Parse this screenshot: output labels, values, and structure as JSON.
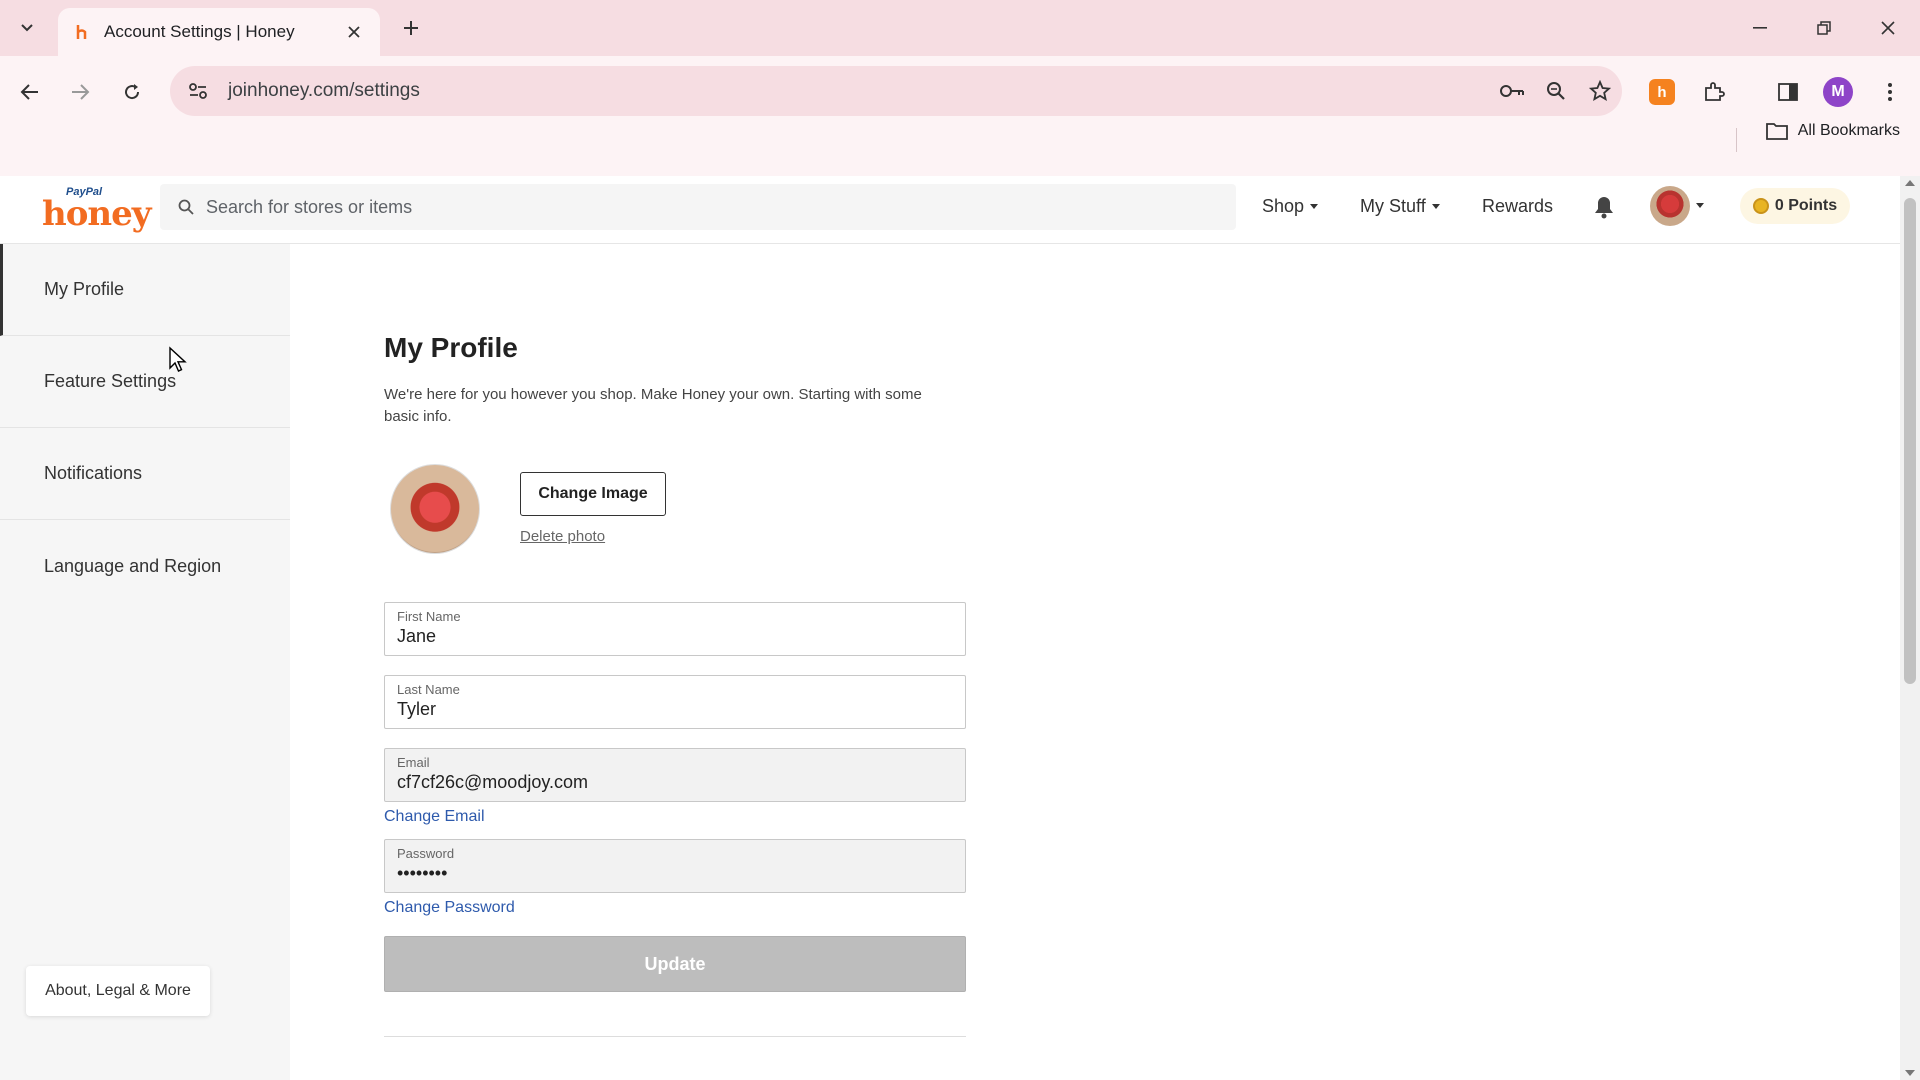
{
  "browser": {
    "tab_title": "Account Settings | Honey",
    "url": "joinhoney.com/settings",
    "bookmarks_label": "All Bookmarks",
    "profile_initial": "M",
    "extension_letter": "h"
  },
  "header": {
    "logo_brand": "PayPal",
    "logo_name": "honey",
    "search_placeholder": "Search for stores or items",
    "nav": {
      "shop": "Shop",
      "my_stuff": "My Stuff",
      "rewards": "Rewards"
    },
    "points": "0 Points"
  },
  "sidebar": {
    "items": [
      {
        "label": "My Profile",
        "active": true
      },
      {
        "label": "Feature Settings",
        "active": false
      },
      {
        "label": "Notifications",
        "active": false
      },
      {
        "label": "Language and Region",
        "active": false
      }
    ],
    "about": "About, Legal & More"
  },
  "profile": {
    "title": "My Profile",
    "description": "We're here for you however you shop. Make Honey your own. Starting with some basic info.",
    "change_image": "Change Image",
    "delete_photo": "Delete photo",
    "first_name": {
      "label": "First Name",
      "value": "Jane"
    },
    "last_name": {
      "label": "Last Name",
      "value": "Tyler"
    },
    "email": {
      "label": "Email",
      "value": "cf7cf26c@moodjoy.com"
    },
    "change_email": "Change Email",
    "password": {
      "label": "Password",
      "value": "••••••••"
    },
    "change_password": "Change Password",
    "update": "Update"
  },
  "colors": {
    "brand_orange": "#f26c21",
    "link_blue": "#2e5aac",
    "chrome_pink": "#f6dde2"
  }
}
